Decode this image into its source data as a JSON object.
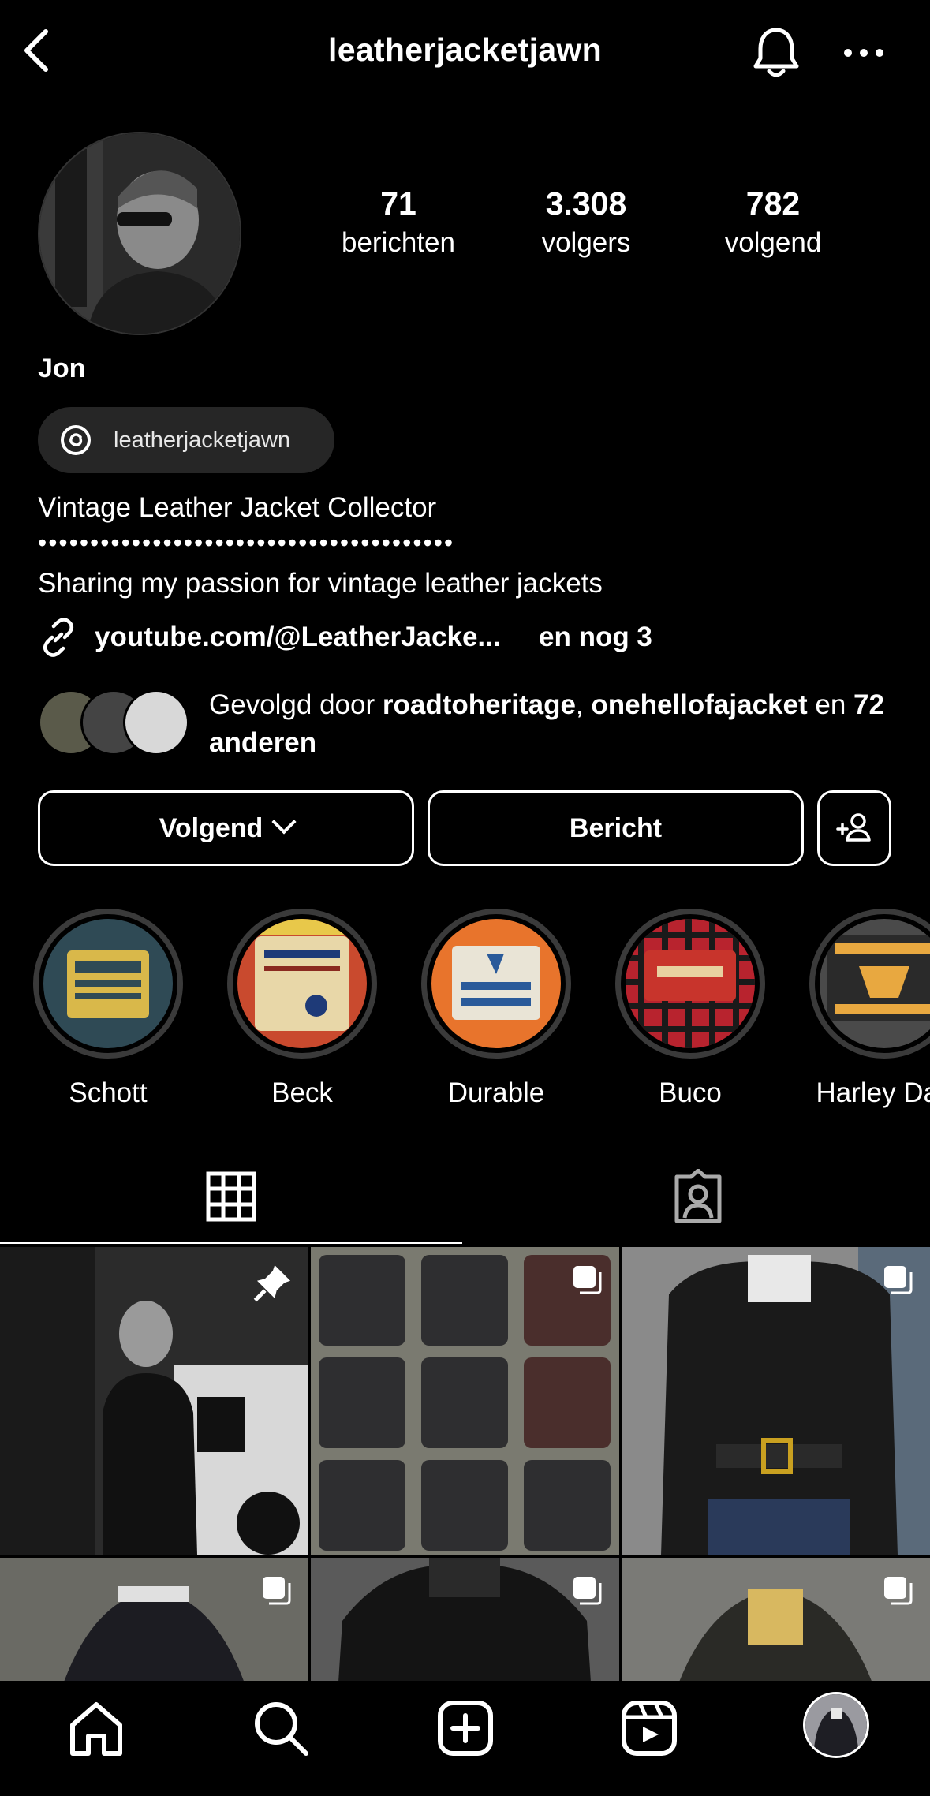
{
  "header": {
    "username": "leatherjacketjawn",
    "icons": [
      "back-arrow-icon",
      "bell-icon",
      "more-icon"
    ]
  },
  "profile": {
    "display_name": "Jon",
    "stats": [
      {
        "value": "71",
        "label": "berichten"
      },
      {
        "value": "3.308",
        "label": "volgers"
      },
      {
        "value": "782",
        "label": "volgend"
      }
    ],
    "threads_handle": "leatherjacketjawn",
    "bio_line1": "Vintage Leather Jacket Collector",
    "bio_dots": "••••••••••••••••••••••••••••••••••••••••",
    "bio_line2": "Sharing my passion for vintage leather jackets",
    "link_text": "youtube.com/@LeatherJacke...",
    "link_more": "en nog 3",
    "mutual": {
      "prefix": "Gevolgd door ",
      "name1": "roadtoheritage",
      "sep": ", ",
      "name2": "onehellofajacket",
      "mid": " en ",
      "others": "72 anderen"
    }
  },
  "actions": {
    "follow_label": "Volgend",
    "message_label": "Bericht"
  },
  "highlights": [
    {
      "label": "Schott",
      "color": "#2f4a55"
    },
    {
      "label": "Beck",
      "color": "#c94a2e"
    },
    {
      "label": "Durable",
      "color": "#e8742c"
    },
    {
      "label": "Buco",
      "color": "#b8232e"
    },
    {
      "label": "Harley Dav",
      "color": "#4a4a4a"
    }
  ],
  "tabs": [
    "grid-icon",
    "tagged-icon"
  ],
  "nav": [
    "home-icon",
    "search-icon",
    "create-icon",
    "reels-icon",
    "profile-avatar"
  ],
  "colors": {
    "background": "#000000",
    "chip": "#262626",
    "ring": "#3a3a3a"
  }
}
